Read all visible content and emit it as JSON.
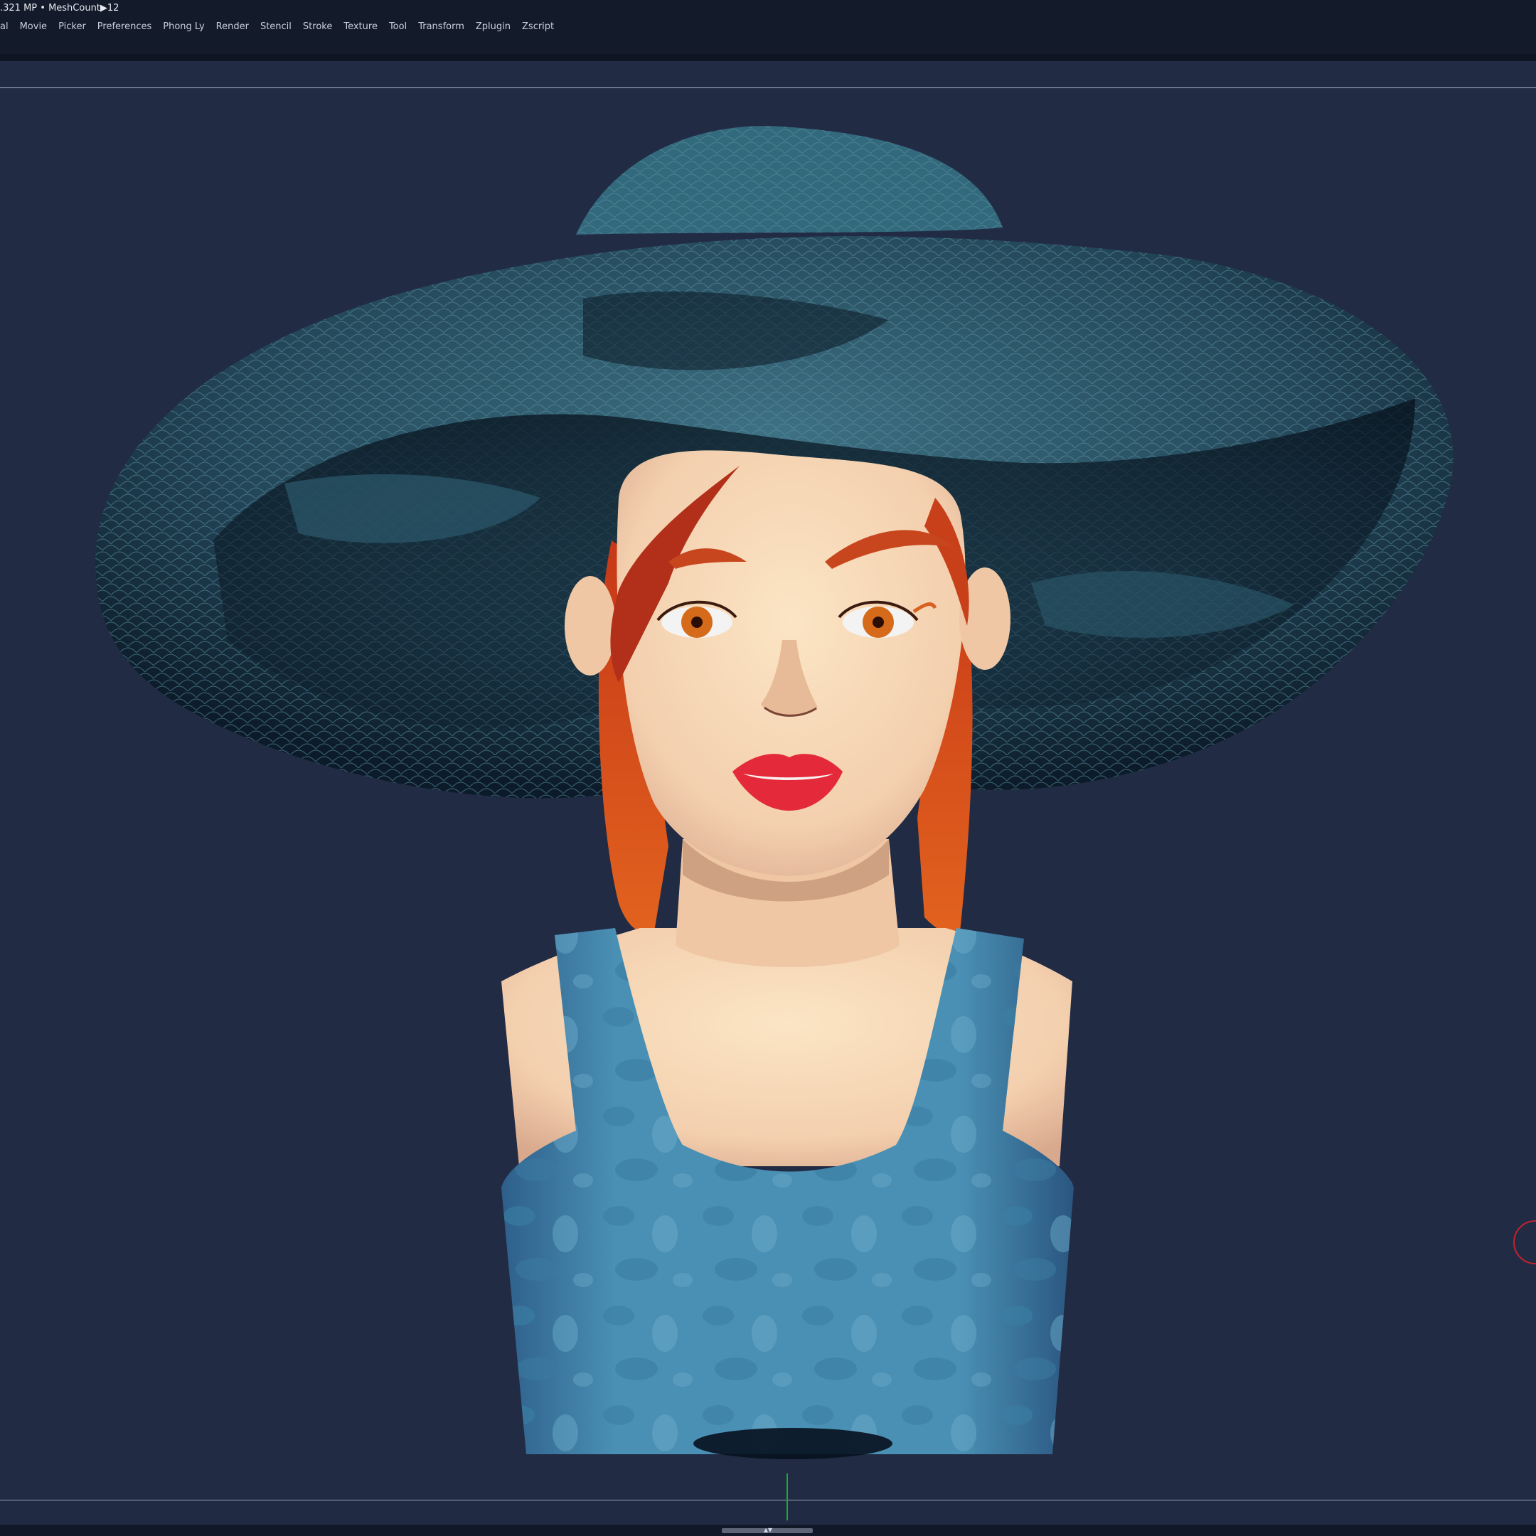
{
  "status": {
    "text": ".321 MP  • MeshCount▶12"
  },
  "menu": {
    "items": [
      "al",
      "Movie",
      "Picker",
      "Preferences",
      "Phong Ly",
      "Render",
      "Stencil",
      "Stroke",
      "Texture",
      "Tool",
      "Transform",
      "Zplugin",
      "Zscript"
    ]
  },
  "viewport": {
    "background": "#222b44",
    "model": "female character bust with wide-brim teal hat, red hair and blue tank top",
    "icons": [
      "gizmo-circle-icon",
      "scroll-arrows-icon"
    ]
  },
  "colors": {
    "hat": "#2c5a6c",
    "hat_dark": "#0b1b2a",
    "skin": "#f4d2b4",
    "hair": "#c8401a",
    "top": "#4d94b6",
    "lips": "#e42a3a",
    "gizmo": "#c0242e",
    "axis": "#1ea838"
  }
}
